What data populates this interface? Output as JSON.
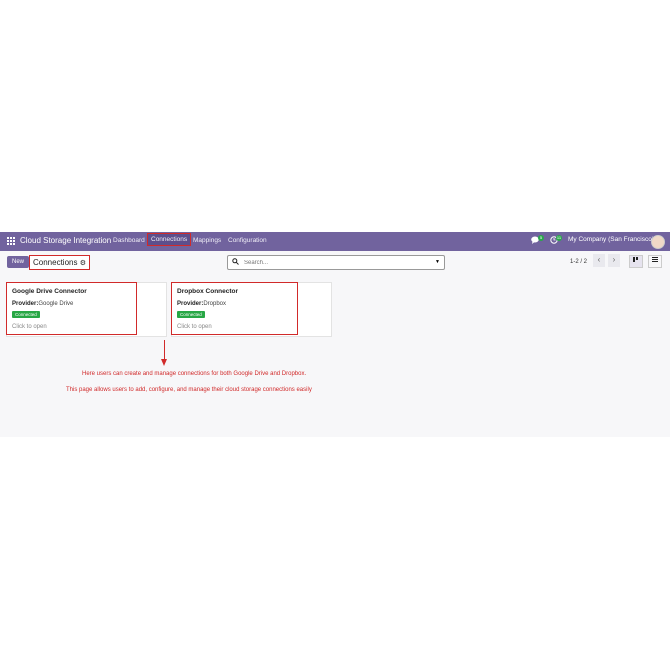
{
  "navbar": {
    "app_name": "Cloud Storage Integration",
    "menus": [
      "Dashboard",
      "Connections",
      "Mappings",
      "Configuration"
    ],
    "active_menu": "Connections",
    "chat_count": "5",
    "activity_count": "11",
    "company": "My Company (San Francisco)"
  },
  "control_panel": {
    "new_label": "New",
    "breadcrumb": "Connections",
    "gear_icon": "⚙",
    "search_placeholder": "Search...",
    "pager": "1-2 / 2",
    "prev": "‹",
    "next": "›"
  },
  "cards": [
    {
      "title": "Google Drive Connector",
      "provider_label": "Provider:",
      "provider": "Google Drive",
      "status": "Connected",
      "hint": "Click to open"
    },
    {
      "title": "Dropbox Connector",
      "provider_label": "Provider:",
      "provider": "Dropbox",
      "status": "Connected",
      "hint": "Click to open"
    }
  ],
  "annotations": {
    "line1": "Here users can create and manage connections for both Google Drive and Dropbox.",
    "line2": "This page allows users to add, configure, and manage their cloud storage connections easily"
  },
  "colors": {
    "brand": "#71639e",
    "highlight": "#d12a2a",
    "status": "#28a745"
  }
}
